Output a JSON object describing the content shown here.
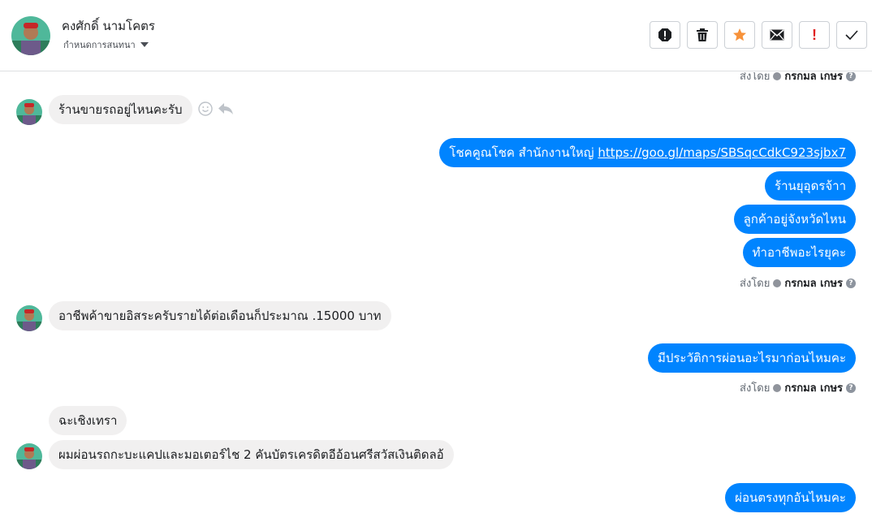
{
  "header": {
    "contact_name": "คงศักดิ์ นามโคตร",
    "assign_label": "กำหนดการสนทนา",
    "toolbar": [
      {
        "icon": "alert-circle-icon"
      },
      {
        "icon": "trash-icon"
      },
      {
        "icon": "star-icon"
      },
      {
        "icon": "envelope-icon"
      },
      {
        "icon": "exclamation-icon",
        "text": "!"
      },
      {
        "icon": "check-icon"
      }
    ]
  },
  "sent_by": {
    "prefix": "ส่งโดย",
    "agent": "กรกมล เกษร",
    "help": "?"
  },
  "messages": {
    "m1": "ร้านขายรถอยู่ไหนคะรับ",
    "m2_text": "โชคคูณโชค สำนักงานใหญ่ ",
    "m2_link": "https://goo.gl/maps/SBSqcCdkC923sjbx7",
    "m3": "ร้านยุอุดรจ้าา",
    "m4": "ลูกค้าอยู่จังหวัดไหน",
    "m5": "ทำอาชีพอะไรยุคะ",
    "m6": "อาชีพค้าขายอิสระครับรายได้ต่อเดือนก็ประมาณ .15000 บาท",
    "m7": "มีประวัติการผ่อนอะไรมาก่อนไหมคะ",
    "m8": "ฉะเชิงเทรา",
    "m9": "ผมผ่อนรถกะบะแคปและมอเตอร์ไช 2 คันบัตรเครดิตอีอ้อนศรีสวัสเงินติดลอ้",
    "m10": "ผ่อนตรงทุกอันไหมคะ"
  },
  "colors": {
    "outgoing": "#0084ff",
    "incoming": "#f1f0f0",
    "star": "#f7923a",
    "flag": "#e02020"
  }
}
